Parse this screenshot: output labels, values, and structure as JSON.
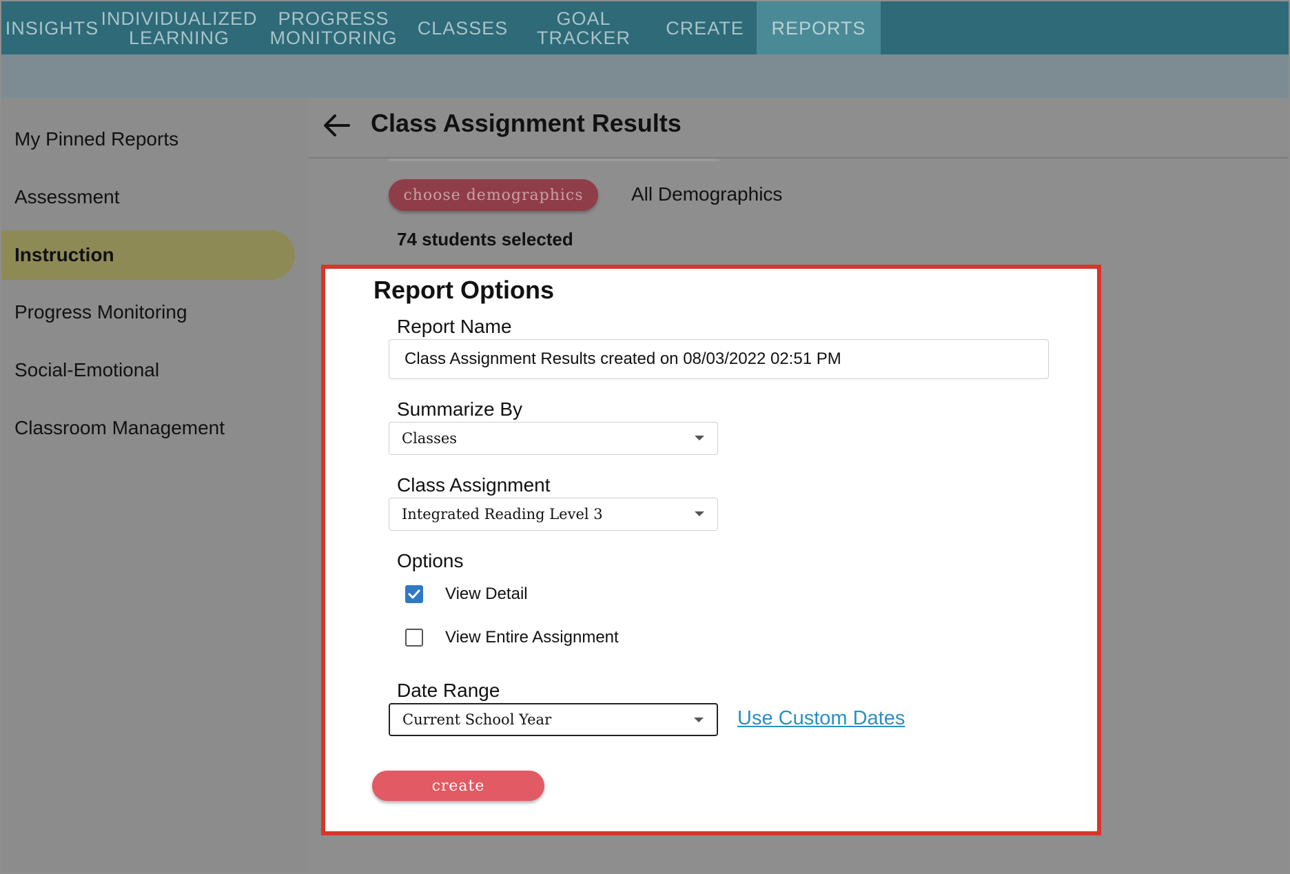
{
  "topnav": {
    "items": [
      {
        "label": "Insights"
      },
      {
        "label": "Individualized\nLearning"
      },
      {
        "label": "Progress\nMonitoring"
      },
      {
        "label": "Classes"
      },
      {
        "label": "Goal Tracker"
      },
      {
        "label": "Create"
      },
      {
        "label": "Reports"
      }
    ],
    "active": "Reports"
  },
  "sidebar": {
    "items": [
      {
        "label": "My Pinned Reports"
      },
      {
        "label": "Assessment"
      },
      {
        "label": "Instruction"
      },
      {
        "label": "Progress Monitoring"
      },
      {
        "label": "Social-Emotional"
      },
      {
        "label": "Classroom Management"
      }
    ],
    "active": "Instruction"
  },
  "header": {
    "title": "Class Assignment Results"
  },
  "demographics": {
    "button_label": "choose demographics",
    "selected": "All Demographics",
    "students_selected": "74 students selected"
  },
  "report_options": {
    "title": "Report Options",
    "report_name_label": "Report Name",
    "report_name_value": "Class Assignment Results created on 08/03/2022 02:51 PM",
    "summarize_by_label": "Summarize By",
    "summarize_by_value": "Classes",
    "class_assignment_label": "Class Assignment",
    "class_assignment_value": "Integrated Reading Level 3",
    "options_label": "Options",
    "view_detail_label": "View Detail",
    "view_entire_label": "View Entire Assignment",
    "date_range_label": "Date Range",
    "date_range_value": "Current School Year",
    "custom_dates_link": "Use Custom Dates",
    "create_label": "create"
  },
  "colors": {
    "nav_bg": "#2e6a78",
    "active_sidebar": "#8e8a56",
    "highlight_border": "#d8352a",
    "create_button": "#e25a63",
    "link": "#2b8fc4",
    "checkbox": "#2f79c4"
  }
}
